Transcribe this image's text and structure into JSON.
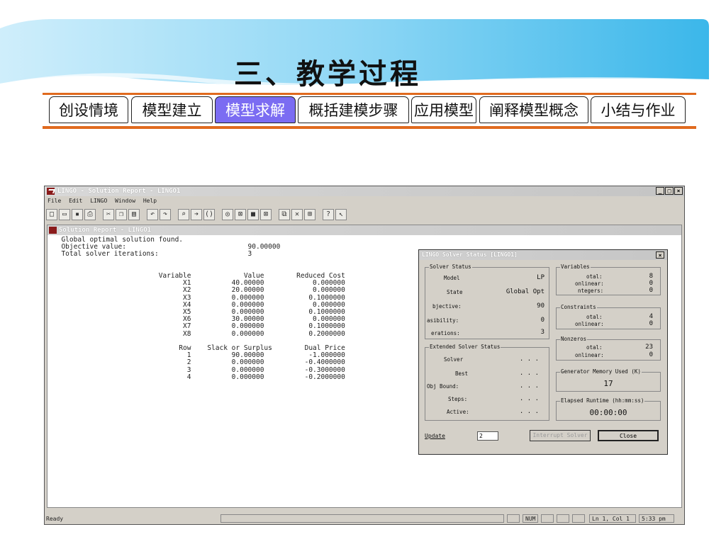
{
  "slide": {
    "title": "三、教学过程",
    "tabs": [
      {
        "label": "创设情境"
      },
      {
        "label": "模型建立"
      },
      {
        "label": "模型求解"
      },
      {
        "label": "概括建模步骤"
      },
      {
        "label": "应用模型"
      },
      {
        "label": "阐释模型概念"
      },
      {
        "label": "小结与作业"
      }
    ],
    "active_tab": "模型求解",
    "accent_color": "#e06a1e",
    "active_tab_color": "#7b6cf2"
  },
  "app": {
    "title": "LINGO - Solution Report - LINGO1",
    "menu": [
      "File",
      "Edit",
      "LINGO",
      "Window",
      "Help"
    ],
    "window_buttons": [
      "_",
      "□",
      "×"
    ],
    "toolbar_icons": [
      "new-icon",
      "open-icon",
      "save-icon",
      "print-icon",
      "cut-icon",
      "copy-icon",
      "paste-icon",
      "undo-icon",
      "redo-icon",
      "find-icon",
      "goto-icon",
      "match-paren-icon",
      "solve-icon",
      "solution-icon",
      "stop-icon",
      "close-icon",
      "send-to-back-icon",
      "close-all-icon",
      "tile-icon",
      "help-icon",
      "context-help-icon"
    ],
    "mdi_title": "Solution Report - LINGO1",
    "report": {
      "header_lines": [
        {
          "label": "Global optimal solution found.",
          "value": ""
        },
        {
          "label": "Objective value:",
          "value": "90.00000"
        },
        {
          "label": "Total solver iterations:",
          "value": "3"
        }
      ],
      "var_headers": [
        "Variable",
        "Value",
        "Reduced Cost"
      ],
      "variables": [
        [
          "X1",
          "40.00000",
          "0.000000"
        ],
        [
          "X2",
          "20.00000",
          "0.000000"
        ],
        [
          "X3",
          "0.000000",
          "0.1000000"
        ],
        [
          "X4",
          "0.000000",
          "0.000000"
        ],
        [
          "X5",
          "0.000000",
          "0.1000000"
        ],
        [
          "X6",
          "30.00000",
          "0.000000"
        ],
        [
          "X7",
          "0.000000",
          "0.1000000"
        ],
        [
          "X8",
          "0.000000",
          "0.2000000"
        ]
      ],
      "row_headers": [
        "Row",
        "Slack or Surplus",
        "Dual Price"
      ],
      "rows": [
        [
          "1",
          "90.00000",
          "-1.000000"
        ],
        [
          "2",
          "0.000000",
          "-0.4000000"
        ],
        [
          "3",
          "0.000000",
          "-0.3000000"
        ],
        [
          "4",
          "0.000000",
          "-0.2000000"
        ]
      ]
    },
    "status_bar": {
      "left": "Ready",
      "num": "NUM",
      "position": "Ln 1, Col 1",
      "time": "5:33 pm"
    }
  },
  "dialog": {
    "title": "LINGO Solver Status [LINGO1]",
    "close_label": "×",
    "solver_status": {
      "label": "Solver Status",
      "model_label": "Model",
      "model": "LP",
      "state_label": "State",
      "state": "Global Opt",
      "objective_label": "bjective:",
      "objective": "90",
      "infeas_label": "asibility:",
      "infeas": "0",
      "iter_label": "erations:",
      "iter": "3"
    },
    "variables": {
      "label": "Variables",
      "total_label": "otal:",
      "total": "8",
      "nonlinear_label": "onlinear:",
      "nonlinear": "0",
      "integers_label": "ntegers:",
      "integers": "0"
    },
    "constraints": {
      "label": "Constraints",
      "total_label": "otal:",
      "total": "4",
      "nonlinear_label": "onlinear:",
      "nonlinear": "0"
    },
    "nonzeros": {
      "label": "Nonzeros",
      "total_label": "otal:",
      "total": "23",
      "nonlinear_label": "onlinear:",
      "nonlinear": "0"
    },
    "extended": {
      "label": "Extended Solver Status",
      "solver_label": "Solver",
      "solver": ". . .",
      "best_label": "Best",
      "best": ". . .",
      "bound_label": "Obj Bound:",
      "bound": ". . .",
      "steps_label": "Steps:",
      "steps": ". . .",
      "active_label": "Active:",
      "active": ". . ."
    },
    "memory": {
      "label": "Generator Memory Used (K)",
      "value": "17"
    },
    "runtime": {
      "label": "Elapsed Runtime (hh:mm:ss)",
      "value": "00:00:00"
    },
    "update_label": "Update",
    "update_value": "2",
    "interrupt_label": "Interrupt Solver",
    "close_button_label": "Close"
  }
}
